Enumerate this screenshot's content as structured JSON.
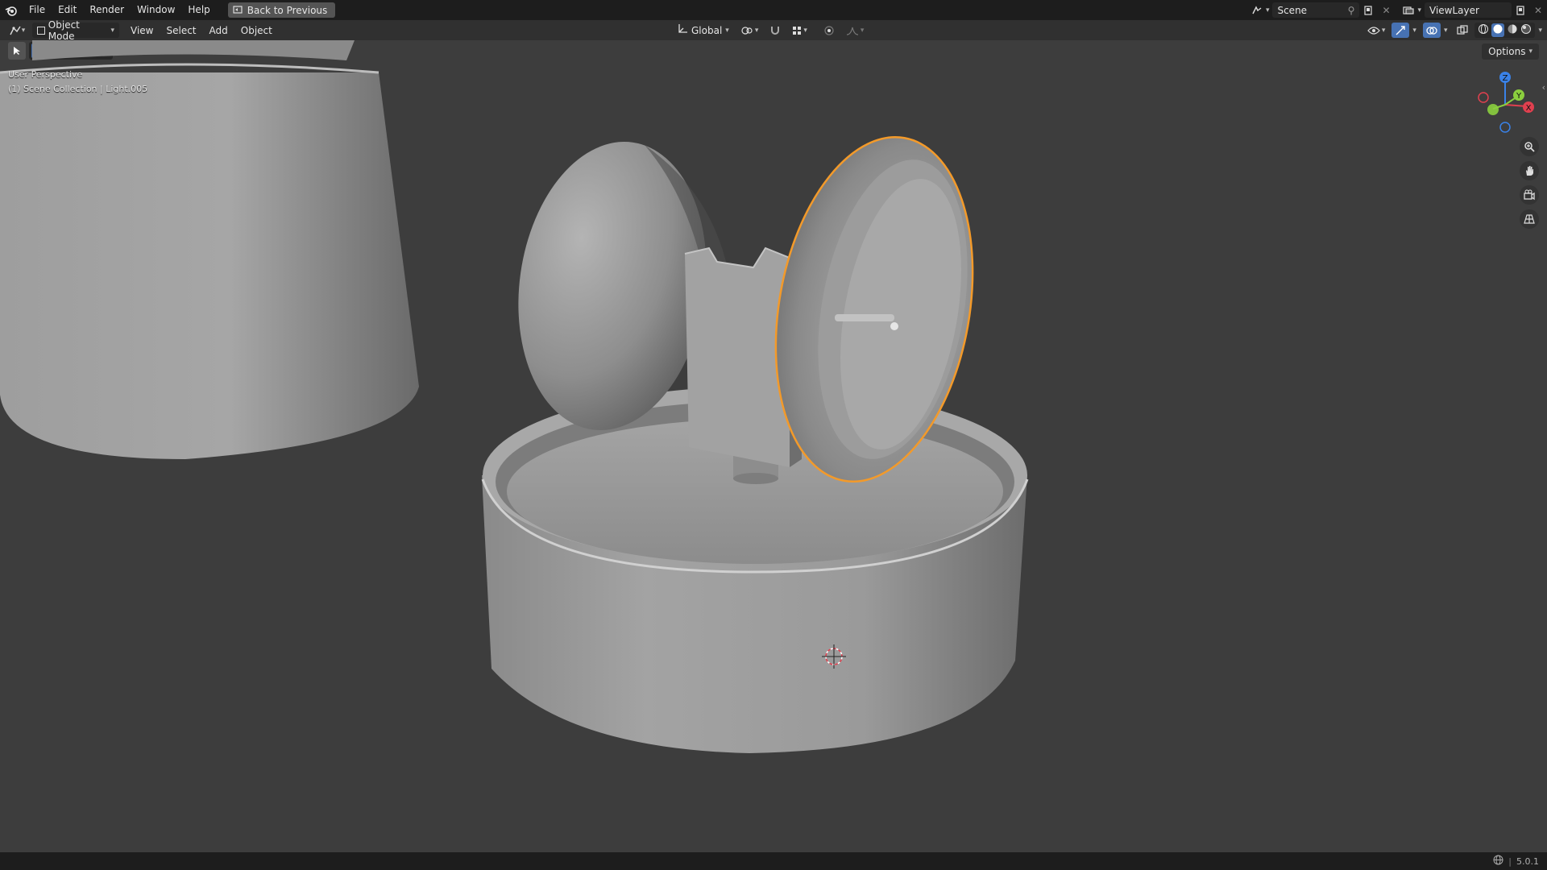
{
  "app": {
    "logo_icon": "blender-logo-icon"
  },
  "menubar": {
    "items": [
      "File",
      "Edit",
      "Render",
      "Window",
      "Help"
    ],
    "back_button": "Back to Previous"
  },
  "topright": {
    "scene_name": "Scene",
    "view_layer": "ViewLayer"
  },
  "header": {
    "mode": "Object Mode",
    "menus": [
      "View",
      "Select",
      "Add",
      "Object"
    ],
    "transform_orientation": "Global"
  },
  "toolbar": {
    "options_label": "Options"
  },
  "viewport": {
    "perspective_label": "User Perspective",
    "collection_label": "(1) Scene Collection | Light.005"
  },
  "gizmo": {
    "axes": [
      "Z",
      "Y",
      "X"
    ],
    "colors": {
      "x": "#e0404f",
      "y": "#8bcf3e",
      "z": "#3a82e8"
    }
  },
  "status": {
    "version": "5.0.1"
  },
  "colors": {
    "selection_outline": "#f39a2a",
    "viewport_bg": "#3d3d3d",
    "active_blue": "#4772b3"
  }
}
